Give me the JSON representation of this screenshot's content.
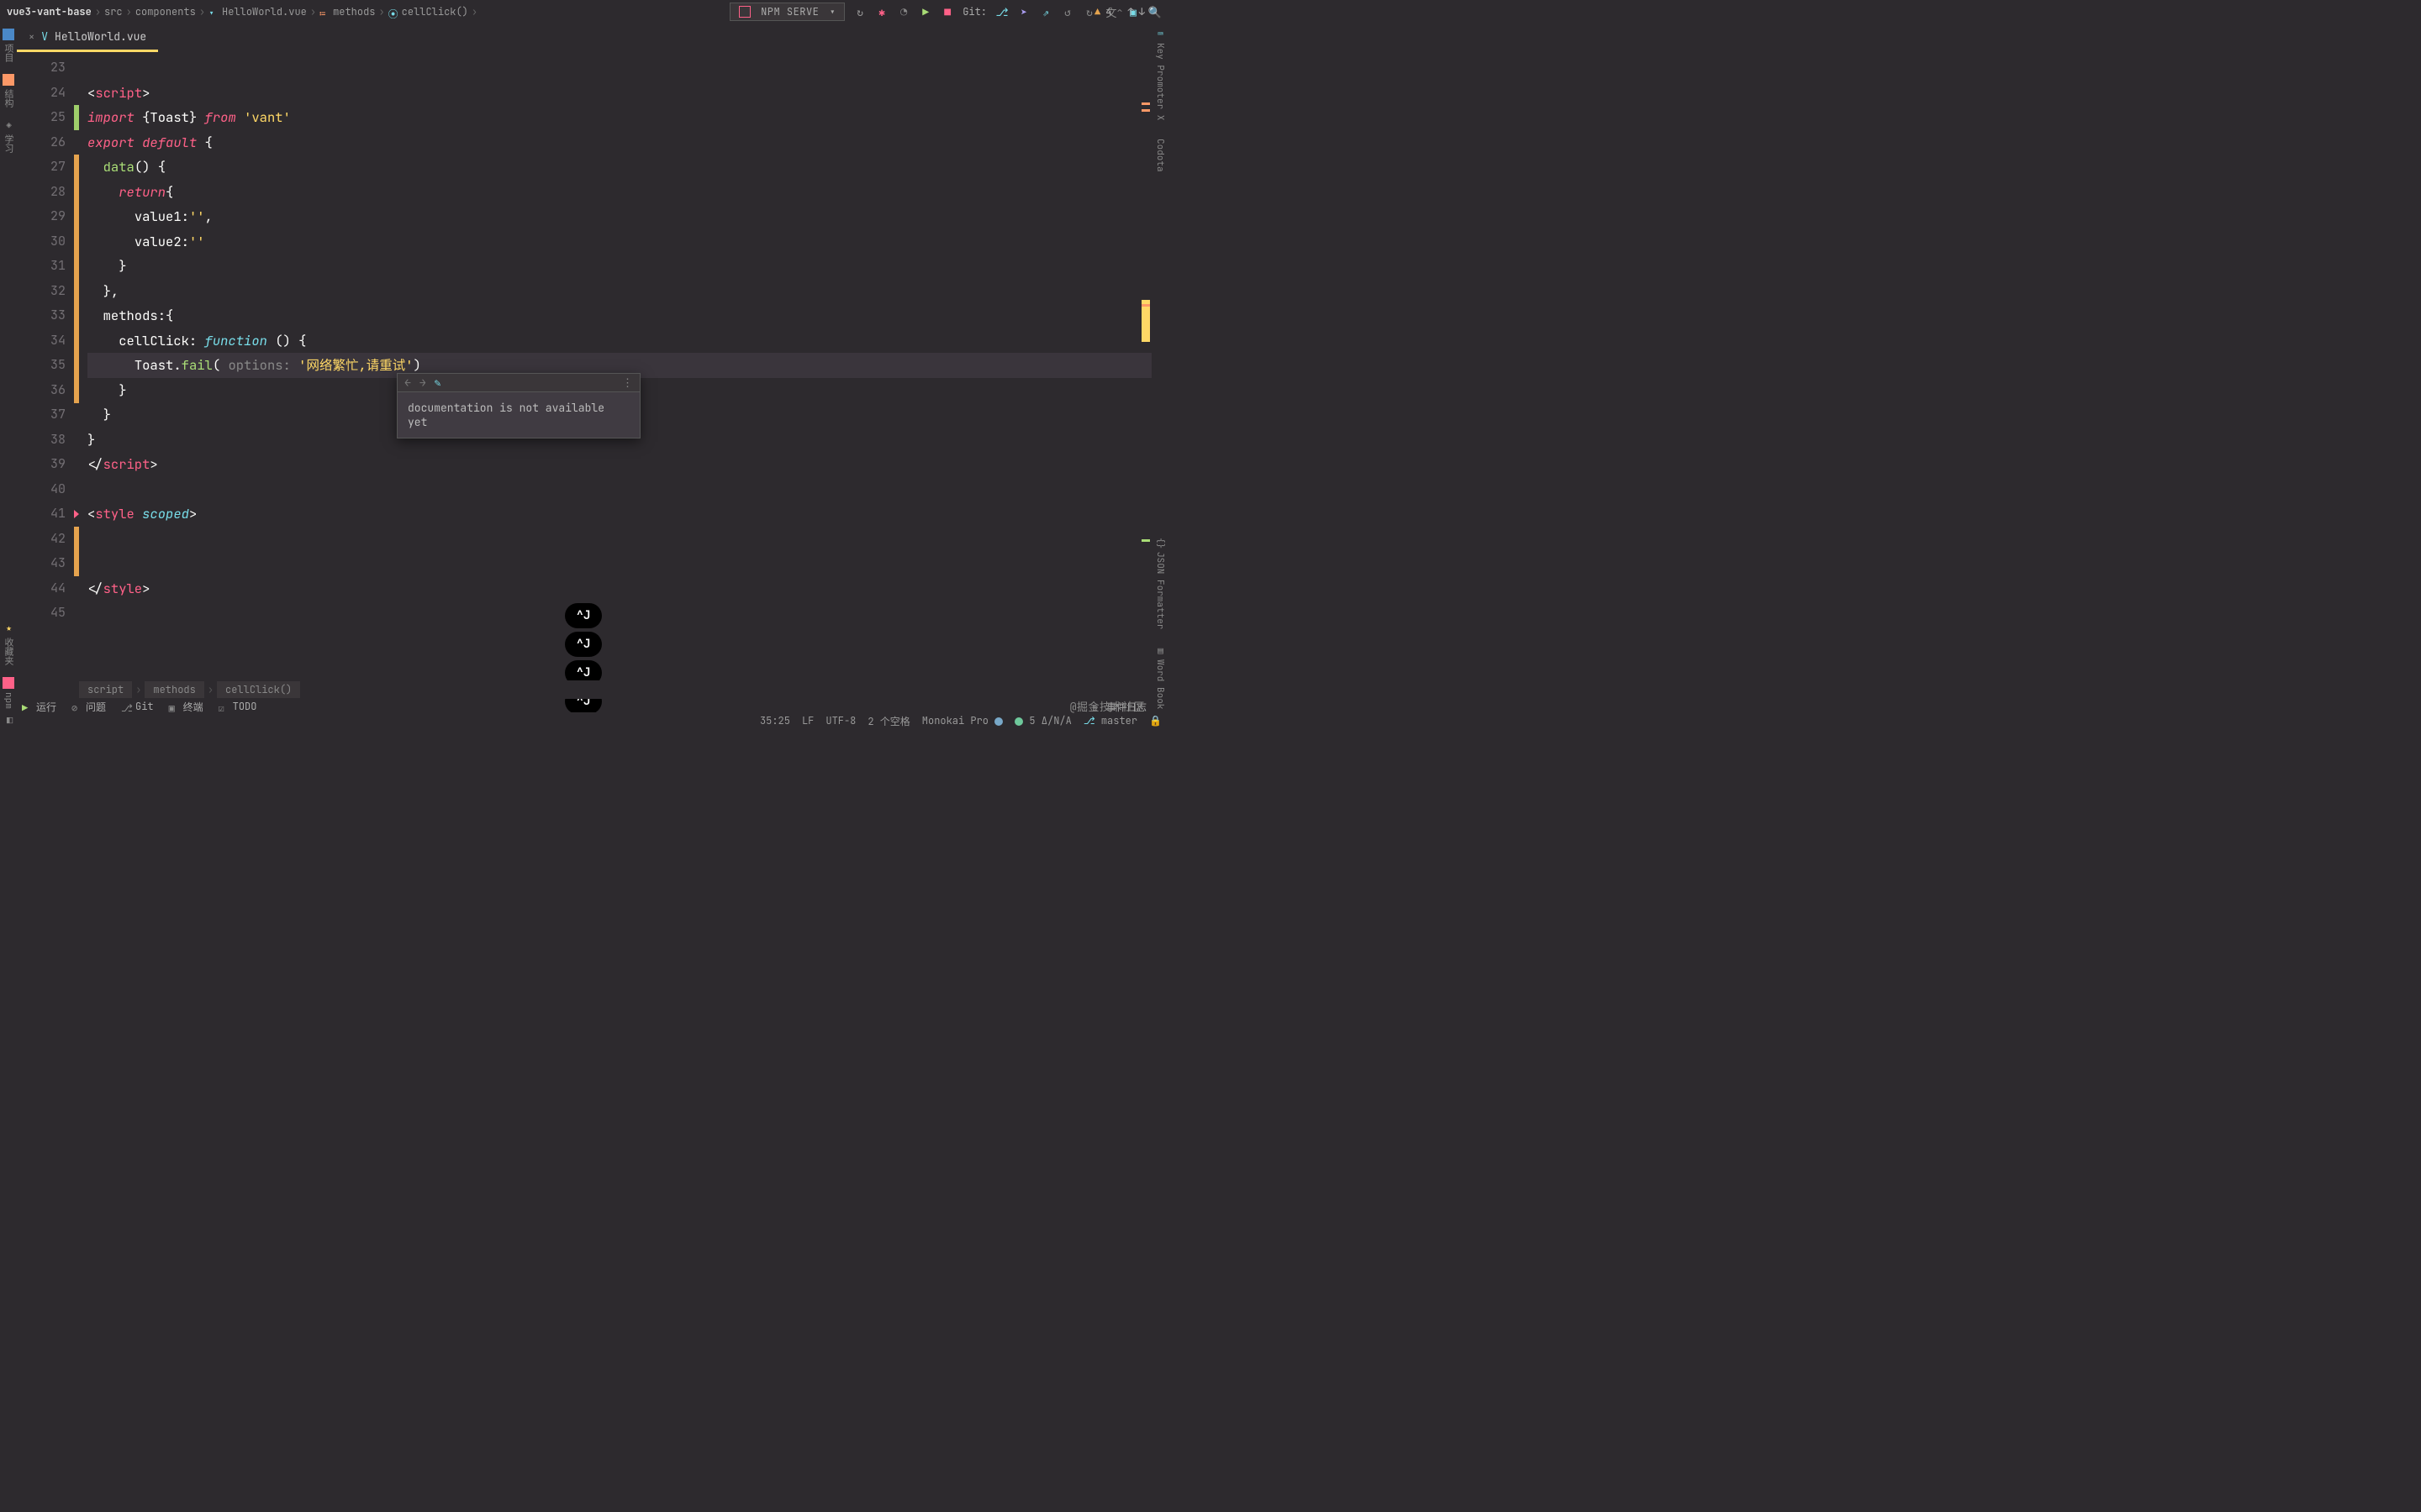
{
  "breadcrumbs": {
    "project": "vue3-vant-base",
    "seg1": "src",
    "seg2": "components",
    "file": "HelloWorld.vue",
    "seg3": "methods",
    "seg4": "cellClick()"
  },
  "runConfig": {
    "label": "NPM SERVE"
  },
  "gitLabel": "Git:",
  "tab": {
    "filename": "HelloWorld.vue"
  },
  "leftRail": {
    "project": "项目",
    "structure": "结构",
    "learn": "学习",
    "favorites": "收藏夹",
    "npm": "npm"
  },
  "rightRail": {
    "keyPromoter": "Key Promoter X",
    "codota": "Codota",
    "jsonFormatter": "JSON Formatter",
    "wordBook": "Word Book"
  },
  "inspections": {
    "caret": "⌃",
    "warnCount": "4",
    "up": "↑",
    "down": "↓"
  },
  "lines": {
    "start": 23,
    "l24_open": "<",
    "l24_tag": "script",
    "l24_close": ">",
    "l25_import": "import",
    "l25_brace1": " {",
    "l25_toast": "Toast",
    "l25_brace2": "}",
    "l25_from": " from ",
    "l25_str": "'vant'",
    "l26_export": "export",
    "l26_default": " default",
    "l26_b": " {",
    "l27_data": "data",
    "l27_p": "()",
    "l27_b": " {",
    "l28_return": "return",
    "l28_b": "{",
    "l29_k": "value1",
    "l29_c": ":",
    "l29_v": "''",
    "l29_comma": ",",
    "l30_k": "value2",
    "l30_c": ":",
    "l30_v": "''",
    "l31_b": "}",
    "l32_b": "},",
    "l33_methods": "methods",
    "l33_c": ":",
    "l33_b": "{",
    "l34_cell": "cellClick",
    "l34_c": ":",
    "l34_fn": " function",
    "l34_p": " () ",
    "l34_b": "{",
    "l35_toast": "Toast",
    "l35_dot": ".",
    "l35_fail": "fail",
    "l35_p1": "(",
    "l35_hint": " options: ",
    "l35_str": "'网络繁忙,请重试'",
    "l35_p2": ")",
    "l36_b": "}",
    "l37_b": "}",
    "l38_b": "}",
    "l39_open": "</",
    "l39_tag": "script",
    "l39_close": ">",
    "l41_open": "<",
    "l41_tag": "style",
    "l41_attr": " scoped",
    "l41_close": ">",
    "l44_open": "</",
    "l44_tag": "style",
    "l44_close": ">"
  },
  "docPopup": {
    "text": "documentation is not available yet"
  },
  "pills": {
    "cj": "^J"
  },
  "structPath": {
    "a": "script",
    "b": "methods",
    "c": "cellClick()"
  },
  "toolWindows": {
    "run": "运行",
    "problems": "问题",
    "git": "Git",
    "terminal": "终端",
    "todo": "TODO",
    "eventLog": "事件日志"
  },
  "status": {
    "pos": "35:25",
    "lineSep": "LF",
    "encoding": "UTF-8",
    "indent": "2 个空格",
    "theme": "Monokai Pro",
    "codota": "5 Δ/N/A",
    "branch": "master"
  },
  "watermark": "@掘金技术社区"
}
